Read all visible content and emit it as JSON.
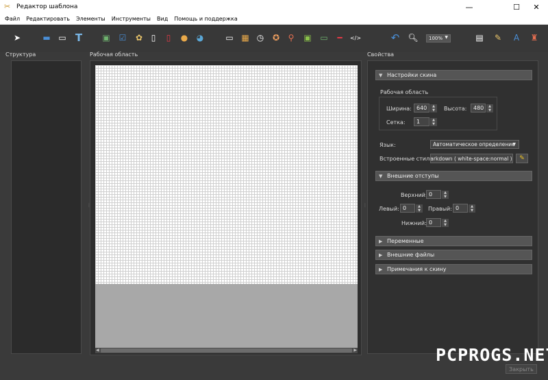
{
  "window": {
    "title": "Редактор шаблона",
    "controls": {
      "minimize": "—",
      "maximize": "☐",
      "close": "✕"
    }
  },
  "menu": [
    "Файл",
    "Редактировать",
    "Элементы",
    "Инструменты",
    "Вид",
    "Помощь и поддержка"
  ],
  "toolbar": {
    "zoom": "100%",
    "icons": [
      "select-pointer-icon",
      "folder-icon",
      "rectangle-icon",
      "text-tool-icon",
      "image-icon",
      "checkbox-icon",
      "doc-icon",
      "pdf-icon",
      "pdf-red-icon",
      "circle-icon",
      "globe-icon",
      "barcode-icon",
      "table-icon",
      "clock-icon",
      "compass-icon",
      "map-pin-icon",
      "picture-icon",
      "screen-icon",
      "line-icon",
      "html-icon",
      "undo-icon",
      "zoom-icon",
      "preview-icon",
      "templates-icon",
      "language-icon",
      "export-icon"
    ]
  },
  "panels": {
    "structure": "Структура",
    "workarea": "Рабочая область",
    "properties": "Свойства"
  },
  "properties": {
    "skin_settings": "Настройки скина",
    "workarea_group": "Рабочая область",
    "width_label": "Ширина:",
    "width_value": "640",
    "height_label": "Высота:",
    "height_value": "480",
    "grid_label": "Сетка:",
    "grid_value": "1",
    "language_label": "Язык:",
    "language_value": "Автоматическое определение",
    "inline_styles_label": "Встроенные стили:",
    "inline_styles_value": "markdown (    white-space:normal )",
    "margins_section": "Внешние отступы",
    "top_label": "Верхний:",
    "top_value": "0",
    "left_label": "Левый:",
    "left_value": "0",
    "right_label": "Правый:",
    "right_value": "0",
    "bottom_label": "Нижний:",
    "bottom_value": "0",
    "variables_section": "Переменные",
    "external_files_section": "Внешние файлы",
    "notes_section": "Примечания к скину"
  },
  "footer": {
    "close_button": "Закрыть",
    "watermark": "PCPROGS.NET"
  }
}
